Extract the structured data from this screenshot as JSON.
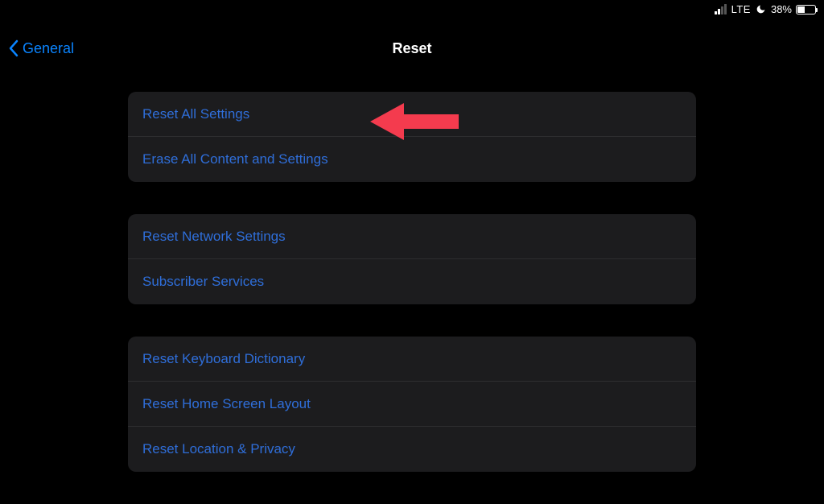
{
  "status_bar": {
    "network_type": "LTE",
    "battery_percent_text": "38%"
  },
  "nav": {
    "back_label": "General",
    "title": "Reset"
  },
  "groups": [
    {
      "rows": [
        {
          "label": "Reset All Settings"
        },
        {
          "label": "Erase All Content and Settings"
        }
      ]
    },
    {
      "rows": [
        {
          "label": "Reset Network Settings"
        },
        {
          "label": "Subscriber Services"
        }
      ]
    },
    {
      "rows": [
        {
          "label": "Reset Keyboard Dictionary"
        },
        {
          "label": "Reset Home Screen Layout"
        },
        {
          "label": "Reset Location & Privacy"
        }
      ]
    }
  ]
}
